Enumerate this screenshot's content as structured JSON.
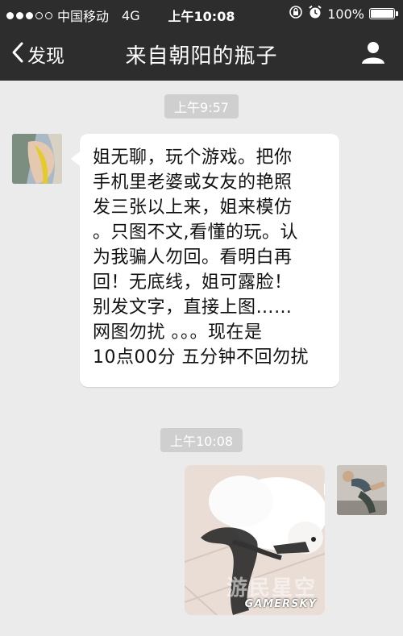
{
  "status_bar": {
    "carrier": "中国移动",
    "network": "4G",
    "time": "上午10:08",
    "battery": "100%",
    "signal_dots_filled": 3,
    "signal_dots_total": 5
  },
  "nav": {
    "back_label": "发现",
    "title": "来自朝阳的瓶子"
  },
  "messages": [
    {
      "timestamp": "上午9:57",
      "sender": "other",
      "type": "text",
      "text": "姐无聊，玩个游戏。把你\n手机里老婆或女友的艳照\n发三张以上来，姐来模仿\n。只图不文,看懂的玩。认\n为我骗人勿回。看明白再\n回！无底线，姐可露脸！\n别发文字，直接上图……\n网图勿扰 。。。现在是\n10点00分 五分钟不回勿扰"
    },
    {
      "timestamp": "上午10:08",
      "sender": "self",
      "type": "image"
    }
  ],
  "watermark": {
    "cn": "游民星空",
    "en": "GAMERSKY"
  },
  "colors": {
    "bar_bg": "#2d2d2d",
    "chat_bg": "#ebebeb",
    "timestamp_bg": "#cfcfcf",
    "bubble_bg": "#ffffff"
  },
  "icons": [
    "chevron-left-icon",
    "person-icon",
    "lock-rotation-icon",
    "alarm-icon"
  ]
}
